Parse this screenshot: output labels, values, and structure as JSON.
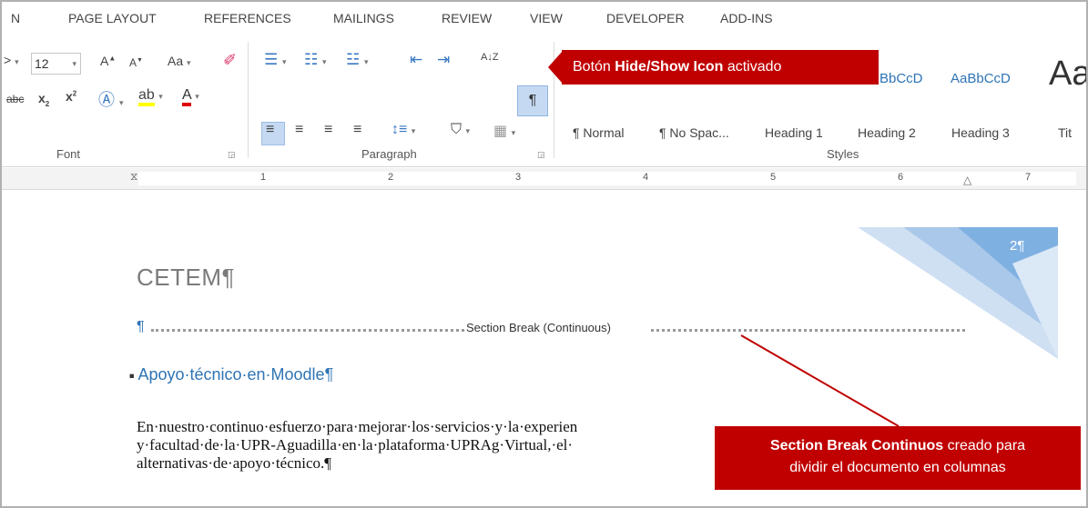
{
  "tabs": [
    "N",
    "PAGE LAYOUT",
    "REFERENCES",
    "MAILINGS",
    "REVIEW",
    "VIEW",
    "DEVELOPER",
    "ADD-INS"
  ],
  "font_group": {
    "font_name_fragment": ">",
    "font_size": "12",
    "grow_label": "A",
    "shrink_label": "A",
    "case_label": "Aa",
    "strike_label": "abc",
    "subscript_label": "x",
    "superscript_label": "x",
    "label": "Font"
  },
  "paragraph_group": {
    "label": "Paragraph",
    "show_hide_glyph": "¶",
    "sort_label": "A↓Z"
  },
  "styles_group": {
    "label": "Styles",
    "samples": [
      "BbCcD",
      "AaBbCcD",
      "Aa"
    ],
    "names": [
      "¶ Normal",
      "¶ No Spac...",
      "Heading 1",
      "Heading 2",
      "Heading 3",
      "Tit"
    ]
  },
  "ruler_numbers": [
    "1",
    "2",
    "3",
    "4",
    "5",
    "6",
    "7"
  ],
  "document": {
    "title": "CETEM",
    "pilcrow": "¶",
    "section_break_label": "Section Break (Continuous)",
    "heading": "Apoyo·técnico·en·Moodle",
    "body_lines": [
      "En·nuestro·continuo·esfuerzo·para·mejorar·los·servicios·y·la·experien",
      "y·facultad·de·la·UPR-Aguadilla·en·la·plataforma·UPRAg·Virtual,·el·",
      "alternativas·de·apoyo·técnico.¶"
    ],
    "page_number": "2¶"
  },
  "callouts": {
    "top_prefix": "Botón ",
    "top_bold": "Hide/Show Icon",
    "top_suffix": " activado",
    "bottom_bold": "Section Break Continuos",
    "bottom_rest_1": " creado para",
    "bottom_line_2": "dividir el documento en columnas"
  },
  "colors": {
    "accent": "#2e74b5",
    "callout": "#c00000",
    "active_button": "#c5daf2"
  }
}
